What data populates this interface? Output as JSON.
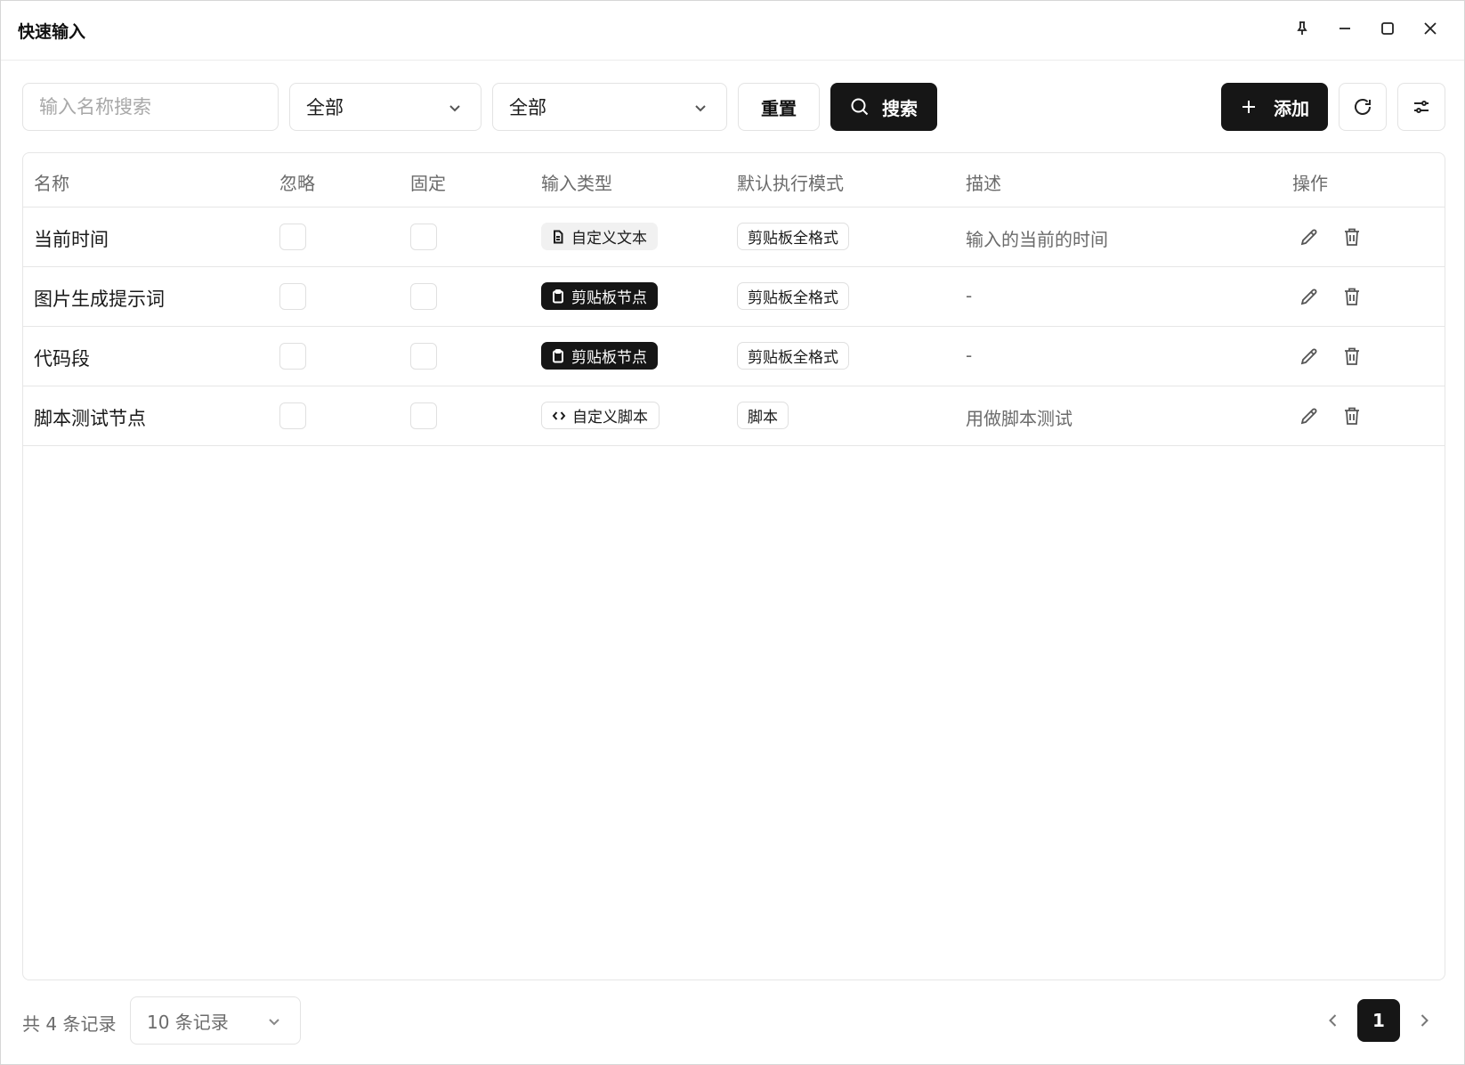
{
  "window": {
    "title": "快速输入",
    "controls": [
      "pin-icon",
      "minimize-icon",
      "maximize-icon",
      "close-icon"
    ]
  },
  "toolbar": {
    "search_placeholder": "输入名称搜索",
    "search_value": "",
    "filter1_value": "全部",
    "filter2_value": "全部",
    "reset_label": "重置",
    "search_label": "搜索",
    "add_label": "添加",
    "icons": {
      "search": "search-icon",
      "add": "plus-icon",
      "refresh": "refresh-icon",
      "settings": "sliders-icon"
    }
  },
  "table": {
    "headers": {
      "name": "名称",
      "ignore": "忽略",
      "pin": "固定",
      "input_type": "输入类型",
      "mode": "默认执行模式",
      "desc": "描述",
      "actions": "操作"
    },
    "rows": [
      {
        "name": "当前时间",
        "ignore": false,
        "pin": false,
        "input_type": "自定义文本",
        "type_style": "light",
        "type_icon": "file-text-icon",
        "mode": "剪贴板全格式",
        "desc": "输入的当前的时间"
      },
      {
        "name": "图片生成提示词",
        "ignore": false,
        "pin": false,
        "input_type": "剪贴板节点",
        "type_style": "dark",
        "type_icon": "clipboard-icon",
        "mode": "剪贴板全格式",
        "desc": "-"
      },
      {
        "name": "代码段",
        "ignore": false,
        "pin": false,
        "input_type": "剪贴板节点",
        "type_style": "dark",
        "type_icon": "clipboard-icon",
        "mode": "剪贴板全格式",
        "desc": "-"
      },
      {
        "name": "脚本测试节点",
        "ignore": false,
        "pin": false,
        "input_type": "自定义脚本",
        "type_style": "outline",
        "type_icon": "code-icon",
        "mode": "脚本",
        "desc": "用做脚本测试"
      }
    ],
    "row_actions": [
      "edit-icon",
      "trash-icon"
    ]
  },
  "footer": {
    "total_text": "共 4 条记录",
    "page_size": "10 条记录",
    "current_page": "1"
  },
  "colors": {
    "primary_dark": "#161616",
    "border": "#e3e3e3",
    "muted_text": "#6b6b6b"
  }
}
